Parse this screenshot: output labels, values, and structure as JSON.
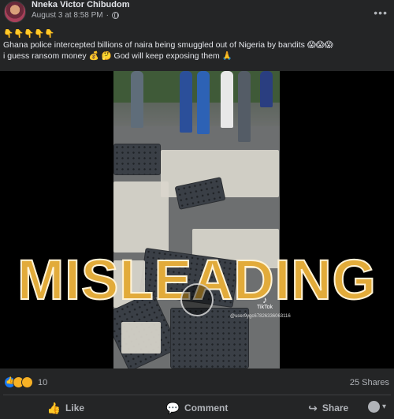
{
  "post": {
    "author": "Nneka Victor Chibudom",
    "timestamp": "August 3 at 8:58 PM",
    "separator": "·",
    "text_line1": "👇👇👇👇👇",
    "text_line2": "Ghana police intercepted billions of naira being smuggled out of Nigeria by bandits 😱😱😱",
    "text_line3": "i guess ransom money 💰 🤔 God will keep exposing them 🙏"
  },
  "video": {
    "overlay_label": "MISLEADING",
    "watermark_brand": "TikTok",
    "watermark_handle": "@user9ygc67826336063116"
  },
  "stats": {
    "reaction_count": "10",
    "shares": "25 Shares"
  },
  "actions": {
    "like": "Like",
    "comment": "Comment",
    "share": "Share"
  },
  "icons": {
    "globe": "globe-icon",
    "more": "more-options-icon",
    "like": "thumbs-up-icon",
    "comment": "comment-bubble-icon",
    "share": "share-arrow-icon",
    "play": "play-icon"
  },
  "colors": {
    "background": "#242526",
    "text": "#e4e6eb",
    "secondary": "#b0b3b8",
    "overlay": "#e2ab3a",
    "like_blue": "#1877f2"
  }
}
